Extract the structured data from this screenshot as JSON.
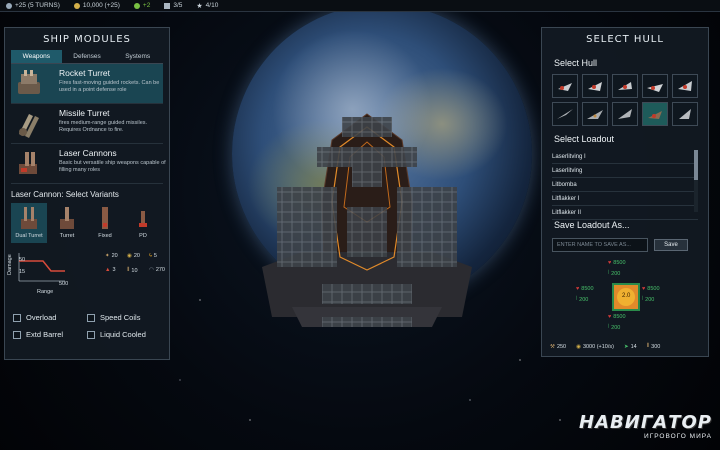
{
  "top_bar": {
    "items": [
      {
        "icon": "influence-icon",
        "text": "+25 (5 TURNS)"
      },
      {
        "icon": "credits-icon",
        "text": "10,000 (+25)"
      },
      {
        "icon": "research-icon",
        "text": "+2"
      },
      {
        "icon": "fleet-icon",
        "text": "3/5"
      },
      {
        "icon": "star-icon",
        "text": "4/10"
      }
    ]
  },
  "left_panel": {
    "title": "SHIP MODULES",
    "tabs": [
      "Weapons",
      "Defenses",
      "Systems"
    ],
    "active_tab": "Weapons",
    "modules": [
      {
        "name": "Rocket Turret",
        "desc": "Fires fast-moving guided rockets. Can be used in a point defense role"
      },
      {
        "name": "Missile Turret",
        "desc": "fires medium-range guided missiles. Requires Ordnance to fire."
      },
      {
        "name": "Laser Cannons",
        "desc": "Basic but versatile ship weapons capable of filling many roles"
      }
    ],
    "variants_title": "Laser Cannon: Select Variants",
    "variants": [
      "Dual Turret",
      "Turret",
      "Fixed",
      "PD"
    ],
    "graph": {
      "ylabel": "Damage",
      "xlabel": "Range",
      "y_top": "50",
      "y_bottom": "15",
      "x_right": "500"
    },
    "stats": {
      "a": "20",
      "b": "20",
      "c": "5",
      "d": "3",
      "e": "10",
      "f": "270"
    },
    "options": [
      "Overload",
      "Speed Coils",
      "Extd Barrel",
      "Liquid Cooled"
    ]
  },
  "right_panel": {
    "title": "SELECT HULL",
    "hull_title": "Select Hull",
    "hull_count": 10,
    "loadout_title": "Select Loadout",
    "loadouts": [
      "Laserlitving I",
      "Laserlitving",
      "Litbomba",
      "Litflakker I",
      "Litflakker II"
    ],
    "save_title": "Save Loadout As...",
    "save_placeholder": "ENTER NAME TO SAVE AS...",
    "save_button": "Save",
    "armor": {
      "top": "8500",
      "top_sub": "200",
      "left": "8500",
      "left_sub": "200",
      "right": "8500",
      "right_sub": "200",
      "bottom": "8500",
      "bottom_sub": "200",
      "center": "2.0"
    },
    "bottom_stats": {
      "hp": "250",
      "energy": "3000 (+10/s)",
      "speed": "14",
      "mass": "300"
    }
  },
  "watermark": {
    "big": "НАВИГАТОР",
    "small": "ИГРОВОГО МИРА"
  },
  "colors": {
    "accent": "#1f5a6a",
    "panel": "#121a22",
    "border": "#3a4652",
    "armor_red": "#d33a3a",
    "armor_green": "#47c06a"
  }
}
